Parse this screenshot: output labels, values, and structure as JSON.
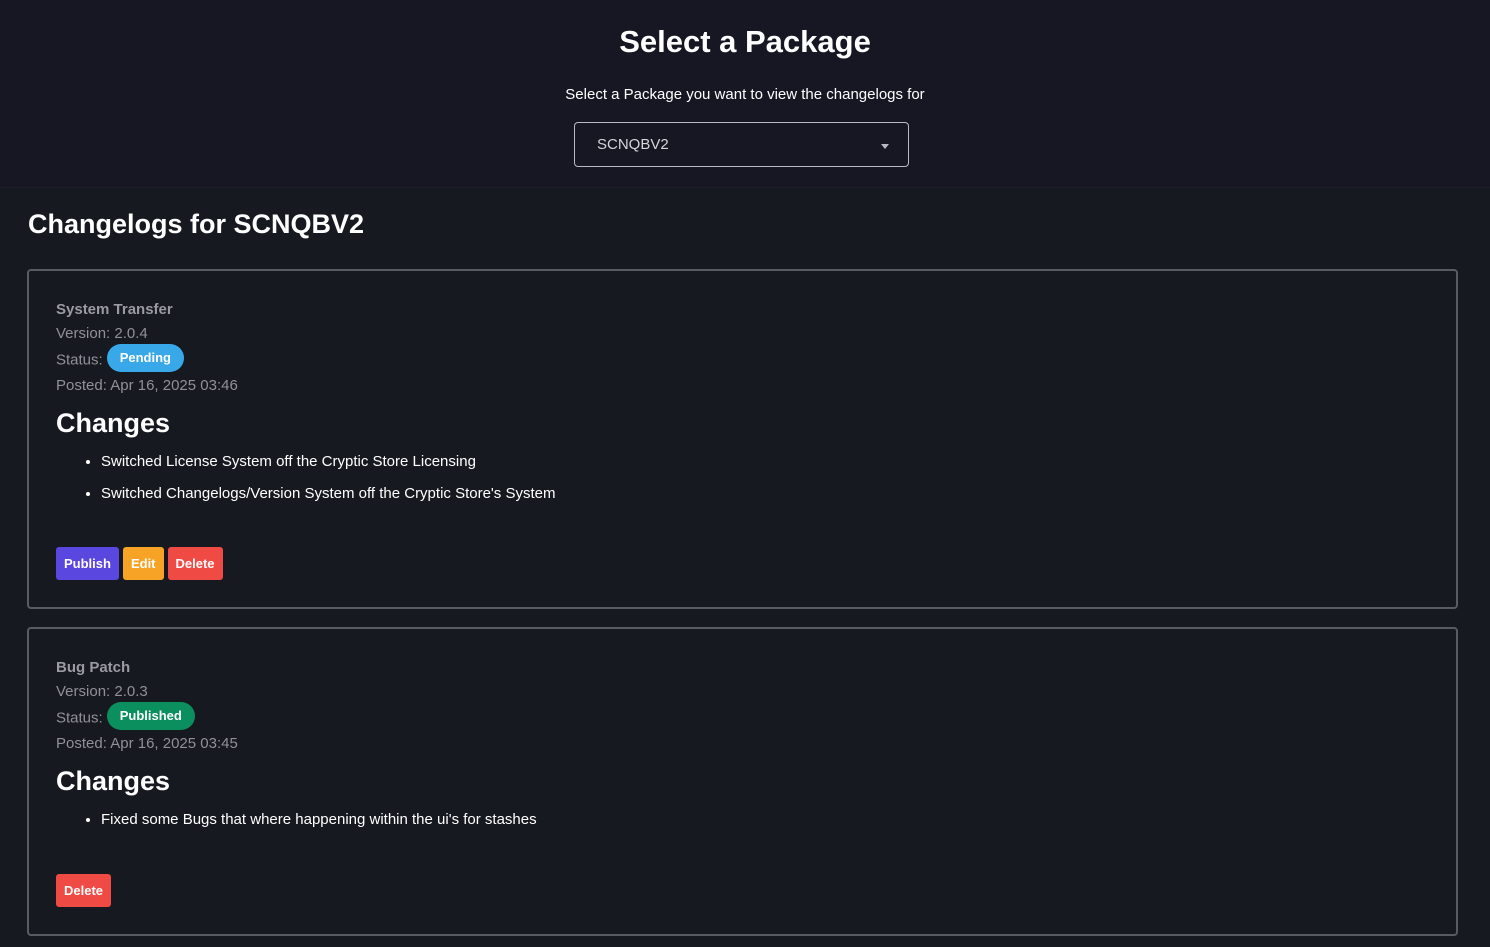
{
  "header": {
    "title": "Select a Package",
    "subtitle": "Select a Package you want to view the changelogs for",
    "package_select": {
      "selected_value": "SCNQBV2"
    }
  },
  "page_title": "Changelogs for SCNQBV2",
  "colors": {
    "status_pending": "#38a8e8",
    "status_published": "#0b8f5e",
    "publish_button": "#5a47e0",
    "edit_button": "#f7a325",
    "delete_button": "#ef4a44"
  },
  "changelogs": [
    {
      "title": "System Transfer",
      "version_label": "Version:",
      "version": "2.0.4",
      "status_label": "Status:",
      "status": "Pending",
      "posted_label": "Posted:",
      "posted": "Apr 16, 2025 03:46",
      "changes_heading": "Changes",
      "changes": [
        "Switched License System off the Cryptic Store Licensing",
        "Switched Changelogs/Version System off the Cryptic Store's System"
      ],
      "buttons": {
        "publish": "Publish",
        "edit": "Edit",
        "delete": "Delete"
      }
    },
    {
      "title": "Bug Patch",
      "version_label": "Version:",
      "version": "2.0.3",
      "status_label": "Status:",
      "status": "Published",
      "posted_label": "Posted:",
      "posted": "Apr 16, 2025 03:45",
      "changes_heading": "Changes",
      "changes": [
        "Fixed some Bugs that where happening within the ui's for stashes"
      ],
      "buttons": {
        "delete": "Delete"
      }
    }
  ]
}
